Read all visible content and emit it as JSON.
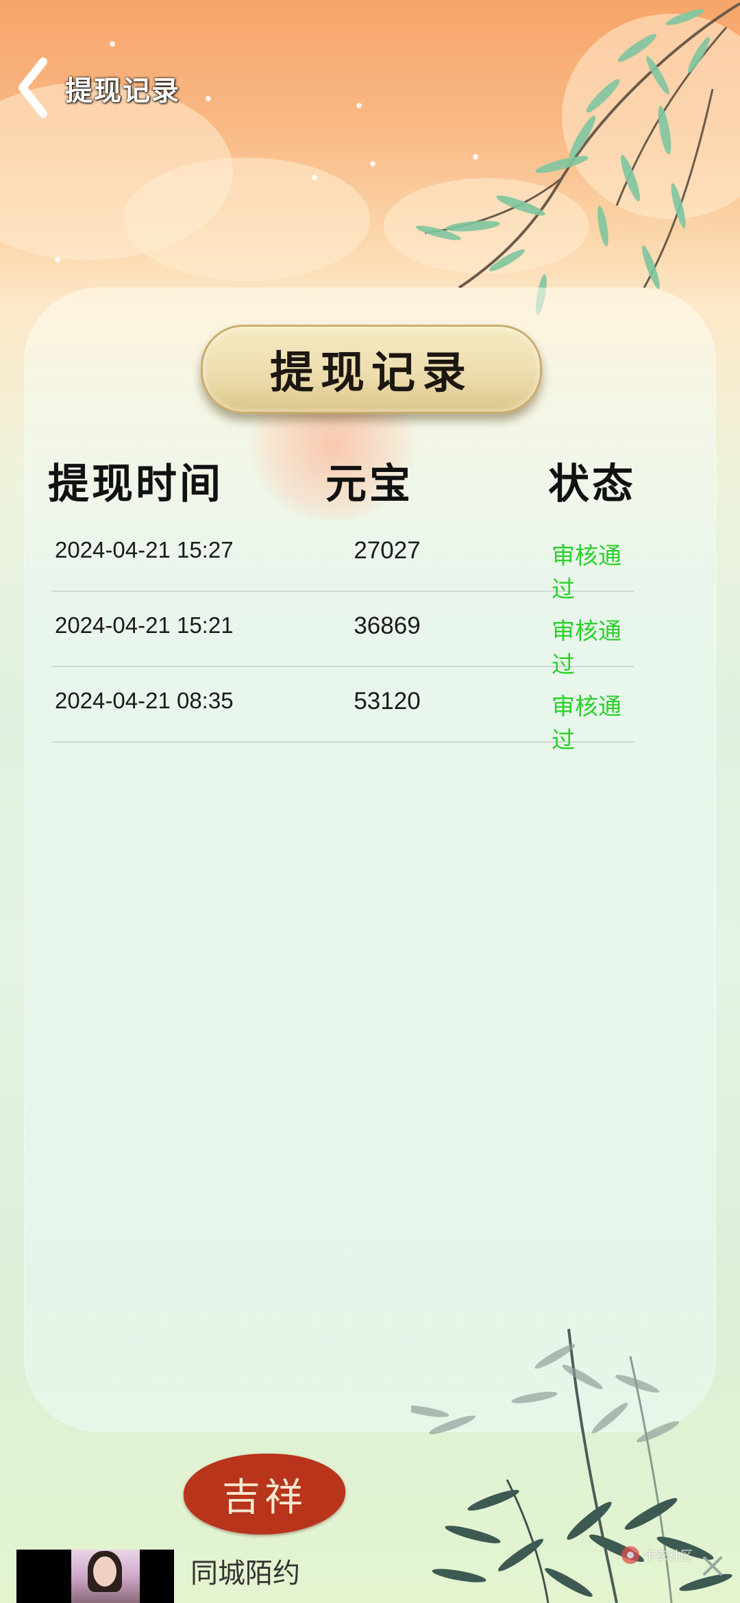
{
  "header": {
    "back_label": "",
    "title": "提现记录"
  },
  "panel": {
    "title": "提现记录",
    "columns": {
      "time": "提现时间",
      "coins": "元宝",
      "status": "状态"
    }
  },
  "records": [
    {
      "time": "2024-04-21 15:27",
      "coins": "27027",
      "status": "审核通过"
    },
    {
      "time": "2024-04-21 15:21",
      "coins": "36869",
      "status": "审核通过"
    },
    {
      "time": "2024-04-21 08:35",
      "coins": "53120",
      "status": "审核通过"
    }
  ],
  "decor": {
    "seal_text": "吉祥"
  },
  "ad": {
    "title": "同城陌约"
  },
  "watermark": {
    "text": "卡农社区"
  },
  "colors": {
    "status_approved": "#2ad12a",
    "seal": "#b8341b"
  },
  "icons": {
    "back": "chevron-left-icon",
    "close": "close-icon"
  }
}
